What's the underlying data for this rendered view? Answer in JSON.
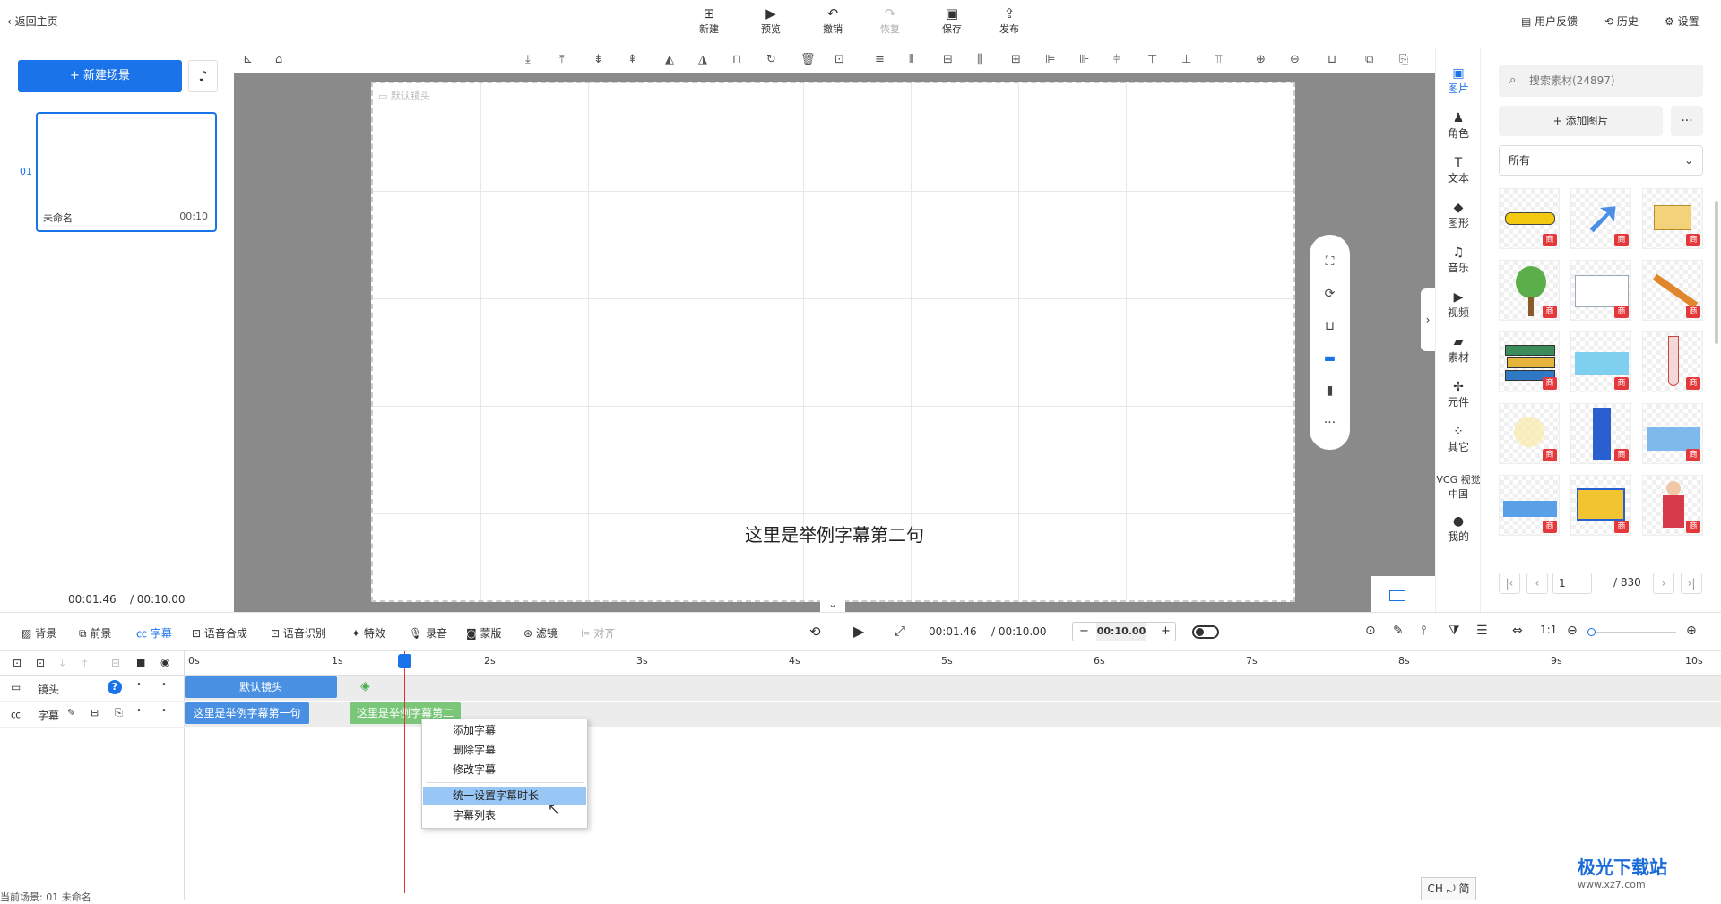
{
  "topbar": {
    "back_label": "返回主页",
    "buttons": [
      {
        "label": "新建",
        "icon": "plus-square-icon"
      },
      {
        "label": "预览",
        "icon": "play-icon"
      },
      {
        "label": "撤销",
        "icon": "undo-icon"
      },
      {
        "label": "恢复",
        "icon": "redo-icon"
      },
      {
        "label": "保存",
        "icon": "save-icon"
      },
      {
        "label": "发布",
        "icon": "publish-icon"
      }
    ],
    "right": [
      "用户反馈",
      "历史",
      "设置"
    ]
  },
  "left_panel": {
    "new_scene_label": "+ 新建场景",
    "scene": {
      "number": "01",
      "name": "未命名",
      "duration": "00:10"
    },
    "current_time": "00:01.46",
    "total_time": "/ 00:10.00"
  },
  "canvas": {
    "camera_label": "默认镜头",
    "subtitle_text": "这里是举例字幕第二句"
  },
  "categories": [
    "图片",
    "角色",
    "文本",
    "图形",
    "音乐",
    "视频",
    "素材",
    "元件",
    "其它",
    "VCG 视觉中国",
    "我的"
  ],
  "assets": {
    "search_placeholder": "搜索素材(24897)",
    "add_image_label": "+ 添加图片",
    "filter_value": "所有",
    "badge_label": "商",
    "page_current": "1",
    "page_total": "/ 830"
  },
  "bottom_toolbar": {
    "tools": [
      "背景",
      "前景",
      "字幕",
      "语音合成",
      "语音识别",
      "特效",
      "录音",
      "蒙版",
      "滤镜",
      "对齐"
    ],
    "active_tool": "字幕",
    "current_time": "00:01.46",
    "total_time": "/ 00:10.00",
    "duration_value": "00:10.00"
  },
  "timeline": {
    "ticks": [
      "0s",
      "1s",
      "2s",
      "3s",
      "4s",
      "5s",
      "6s",
      "7s",
      "8s",
      "9s",
      "10s"
    ],
    "tracks": [
      {
        "name": "镜头",
        "clips": [
          {
            "label": "默认镜头",
            "color": "#4a90e2"
          }
        ]
      },
      {
        "name": "字幕",
        "clips": [
          {
            "label": "这里是举例字幕第一句",
            "color": "#4a90e2"
          },
          {
            "label": "这里是举例字幕第二",
            "color": "#7ac77a"
          }
        ]
      }
    ],
    "playhead_time_s": 1.46
  },
  "context_menu": {
    "items": [
      "添加字幕",
      "删除字幕",
      "修改字幕",
      "统一设置字幕时长",
      "字幕列表"
    ],
    "highlighted": "统一设置字幕时长"
  },
  "statusbar": {
    "text": "当前场景: 01   未命名"
  },
  "ime": {
    "text": "CH ⤾ 简"
  },
  "watermark": {
    "text": "极光下载站",
    "sub": "www.xz7.com"
  }
}
